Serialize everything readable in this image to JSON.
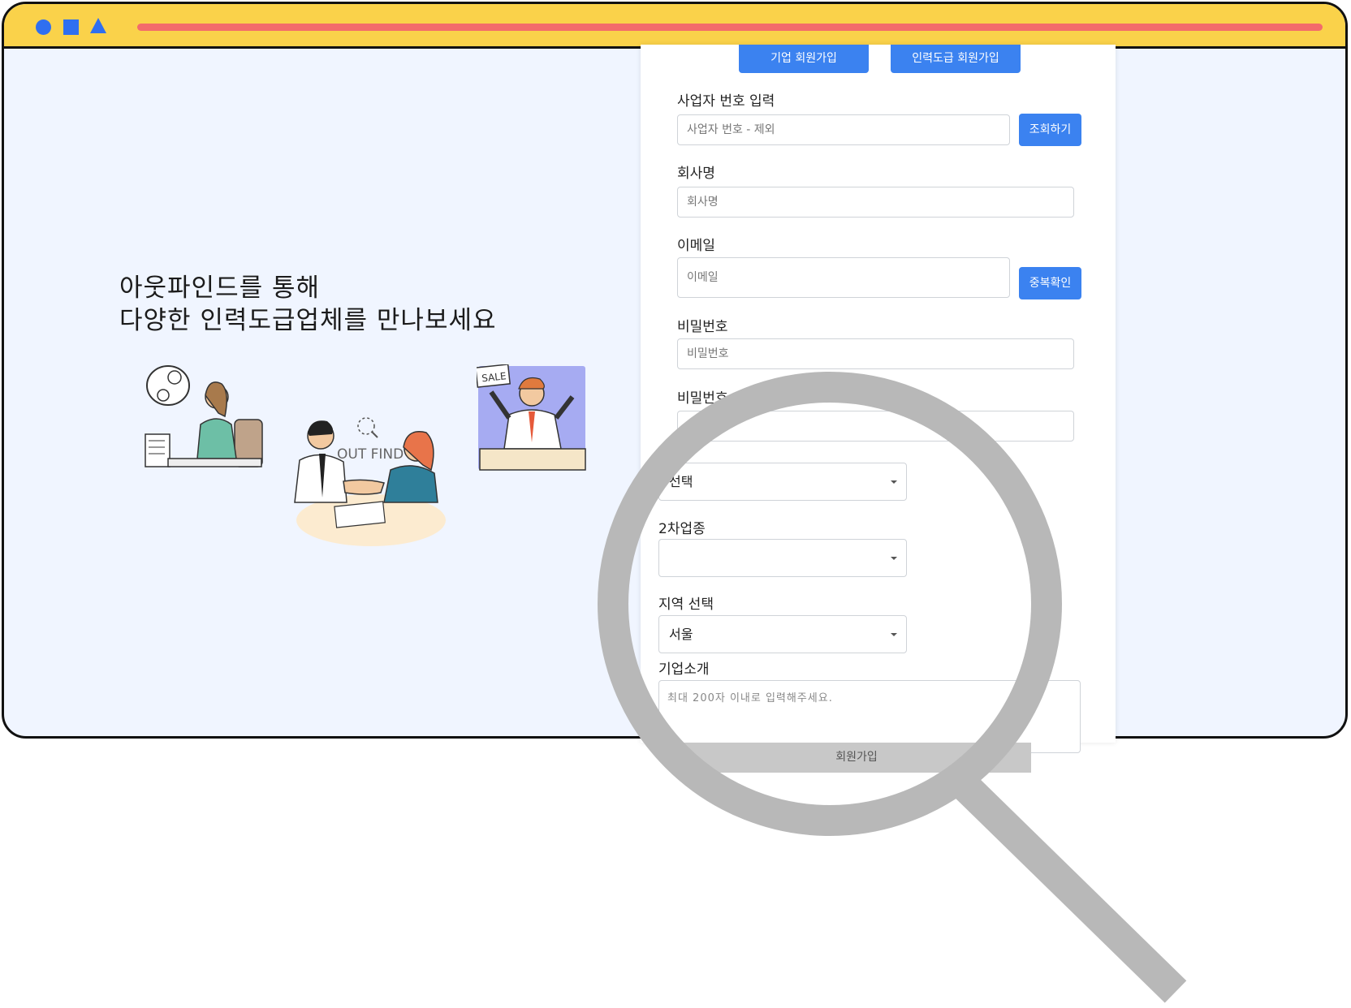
{
  "colors": {
    "titlebar": "#fad24a",
    "titlebar_shapes": "#2f6ff0",
    "address_bar": "#f36b6b",
    "page_background": "#f0f5ff",
    "primary_button": "#3b82f0",
    "submit_button": "#c8c8c8",
    "magnifier": "#b8b8b8"
  },
  "hero": {
    "line1": "아웃파인드를 통해",
    "line2": "다양한 인력도급업체를 만나보세요",
    "illustration_text_sale": "SALE",
    "illustration_text_logo": "OUT FIND"
  },
  "tabs": {
    "company_signup": "기업 회원가입",
    "contractor_signup": "인력도급 회원가입"
  },
  "form": {
    "business_number": {
      "label": "사업자 번호 입력",
      "placeholder": "사업자 번호 - 제외",
      "button": "조회하기"
    },
    "company_name": {
      "label": "회사명",
      "placeholder": "회사명"
    },
    "email": {
      "label": "이메일",
      "placeholder": "이메일",
      "button": "중복확인"
    },
    "password": {
      "label": "비밀번호",
      "placeholder": "비밀번호"
    },
    "password_confirm": {
      "label": "비밀번호"
    },
    "industry_primary": {
      "selected": "선택"
    },
    "industry_secondary": {
      "label": "2차업종",
      "selected": ""
    },
    "region": {
      "label": "지역 선택",
      "selected": "서울"
    },
    "intro": {
      "label": "기업소개",
      "placeholder": "최대 200자 이내로 입력해주세요."
    },
    "submit": "회원가입"
  },
  "icons": [
    "magnifier-icon",
    "dropdown-caret-icon"
  ]
}
